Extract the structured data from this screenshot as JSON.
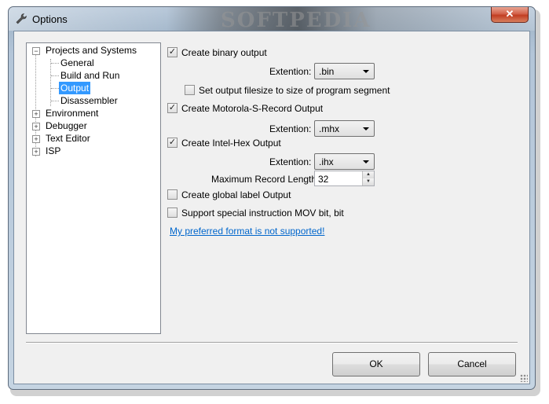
{
  "window": {
    "title": "Options",
    "watermark": "SOFTPEDIA",
    "close_label": "✕"
  },
  "tree": {
    "items": [
      {
        "label": "Projects and Systems",
        "expander": "−"
      },
      {
        "label": "General"
      },
      {
        "label": "Build and Run"
      },
      {
        "label": "Output",
        "selected": true
      },
      {
        "label": "Disassembler"
      },
      {
        "label": "Environment",
        "expander": "+"
      },
      {
        "label": "Debugger",
        "expander": "+"
      },
      {
        "label": "Text Editor",
        "expander": "+"
      },
      {
        "label": "ISP",
        "expander": "+"
      }
    ]
  },
  "output": {
    "binary": {
      "label": "Create binary output",
      "checked": true,
      "ext_label": "Extention:",
      "ext_value": ".bin"
    },
    "set_filesize": {
      "label": "Set output filesize to size of program segment",
      "checked": false
    },
    "motorola": {
      "label": "Create Motorola-S-Record Output",
      "checked": true,
      "ext_label": "Extention:",
      "ext_value": ".mhx"
    },
    "intel": {
      "label": "Create Intel-Hex Output",
      "checked": true,
      "ext_label": "Extention:",
      "ext_value": ".ihx",
      "max_len_label": "Maximum Record Length:",
      "max_len_value": "32"
    },
    "global_label": {
      "label": "Create global label Output",
      "checked": false
    },
    "mov_bit": {
      "label": "Support special instruction MOV bit, bit",
      "checked": false
    },
    "link": "My preferred format is not supported!"
  },
  "buttons": {
    "ok": "OK",
    "cancel": "Cancel"
  },
  "icons": {
    "title_icon": "wrench-icon",
    "check_glyph": "✓"
  },
  "colors": {
    "selection": "#3399ff",
    "link": "#0066cc",
    "close": "#c23d22"
  }
}
